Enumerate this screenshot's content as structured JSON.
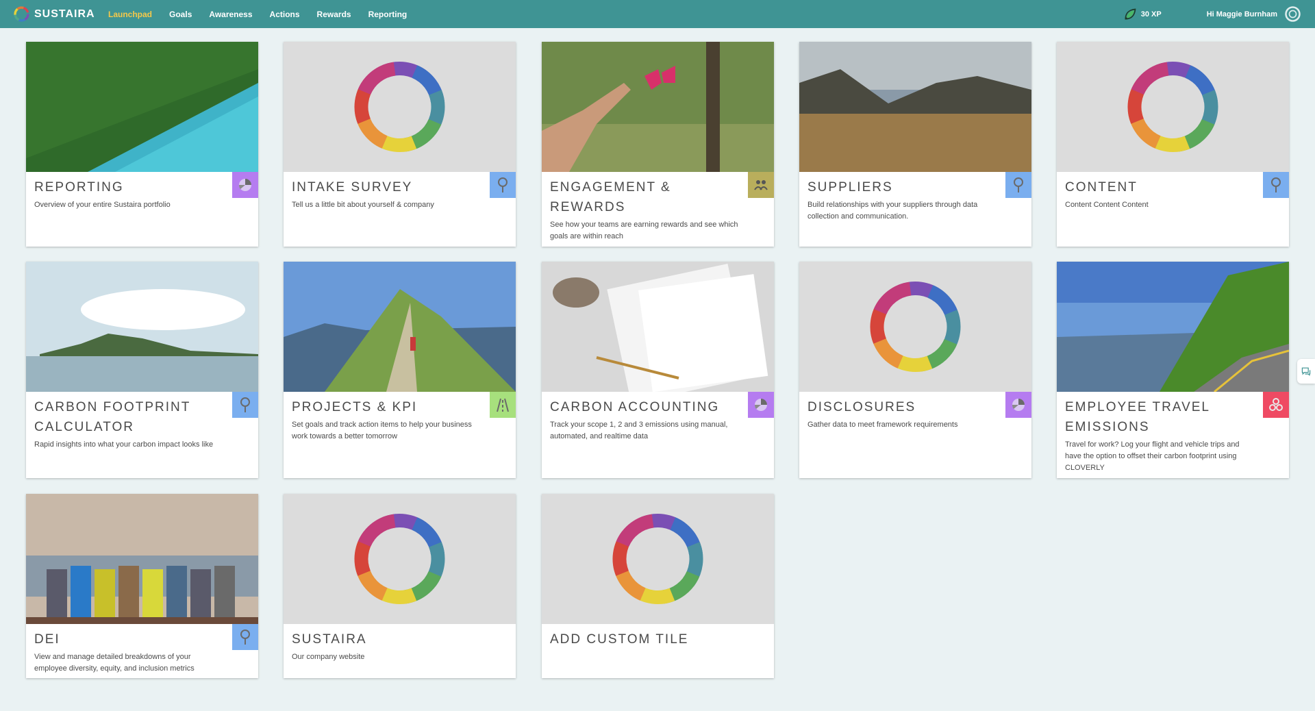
{
  "app": {
    "name": "SUSTAIRA"
  },
  "nav": {
    "items": [
      "Launchpad",
      "Goals",
      "Awareness",
      "Actions",
      "Rewards",
      "Reporting"
    ],
    "active": "Launchpad"
  },
  "header": {
    "xp": "30 XP",
    "greeting": "Hi Maggie Burnham"
  },
  "colors": {
    "topbar": "#3f9494",
    "active_nav": "#f5c94a",
    "background": "#eaf2f3",
    "badge_purple": "#b57cf0",
    "badge_blue": "#7aaeef",
    "badge_olive": "#b9ae5c",
    "badge_green": "#a7e07d",
    "badge_red": "#ef4a63"
  },
  "tiles": [
    {
      "title": "REPORTING",
      "description": "Overview of your entire Sustaira portfolio",
      "image": "aerial-forest-lake",
      "badge_icon": "pie-chart-icon",
      "badge_color": "#b57cf0"
    },
    {
      "title": "INTAKE SURVEY",
      "description": "Tell us a little bit about yourself & company",
      "image": "sustaira-logo",
      "badge_icon": "pin-icon",
      "badge_color": "#7aaeef"
    },
    {
      "title": "ENGAGEMENT & REWARDS",
      "description": "See how your teams are earning rewards and see which goals are within reach",
      "image": "hand-butterfly",
      "badge_icon": "people-icon",
      "badge_color": "#b9ae5c"
    },
    {
      "title": "SUPPLIERS",
      "description": "Build relationships with your suppliers through data collection and communication.",
      "image": "mountain-valley",
      "badge_icon": "pin-icon",
      "badge_color": "#7aaeef"
    },
    {
      "title": "CONTENT",
      "description": "Content Content Content",
      "image": "sustaira-logo",
      "badge_icon": "pin-icon",
      "badge_color": "#7aaeef"
    },
    {
      "title": "CARBON FOOTPRINT CALCULATOR",
      "description": "Rapid insights into what your carbon impact looks like",
      "image": "island-sea",
      "badge_icon": "pin-icon",
      "badge_color": "#7aaeef"
    },
    {
      "title": "PROJECTS & KPI",
      "description": "Set goals and track action items to help your business work towards a better tomorrow",
      "image": "mountain-ridge-hiker",
      "badge_icon": "road-icon",
      "badge_color": "#a7e07d"
    },
    {
      "title": "CARBON ACCOUNTING",
      "description": "Track your scope 1, 2 and 3 emissions using manual, automated, and realtime data",
      "image": "papers-desk",
      "badge_icon": "pie-chart-icon",
      "badge_color": "#b57cf0"
    },
    {
      "title": "DISCLOSURES",
      "description": "Gather data to meet framework requirements",
      "image": "sustaira-logo",
      "badge_icon": "pie-chart-icon",
      "badge_color": "#b57cf0"
    },
    {
      "title": "EMPLOYEE TRAVEL EMISSIONS",
      "description": "Travel for work? Log your flight and vehicle trips and have the option to offset their carbon footprint using CLOVERLY",
      "image": "mountain-road",
      "badge_icon": "coins-icon",
      "badge_color": "#ef4a63"
    },
    {
      "title": "DEI",
      "description": "View and manage detailed breakdowns of your employee diversity, equity, and inclusion metrics",
      "image": "friends-group",
      "badge_icon": "pin-icon",
      "badge_color": "#7aaeef"
    },
    {
      "title": "SUSTAIRA",
      "description": "Our company website",
      "image": "sustaira-logo",
      "badge_icon": "",
      "badge_color": ""
    },
    {
      "title": "ADD CUSTOM TILE",
      "description": "",
      "image": "sustaira-logo",
      "badge_icon": "",
      "badge_color": ""
    }
  ]
}
